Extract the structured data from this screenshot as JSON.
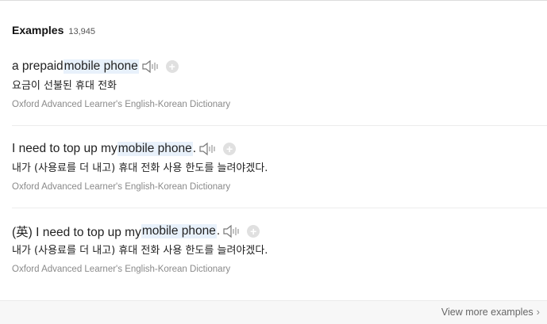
{
  "header": {
    "title": "Examples",
    "count": "13,945"
  },
  "examples": [
    {
      "pre": "a prepaid ",
      "highlight": "mobile phone",
      "post": "",
      "translation": "요금이 선불된 휴대 전화",
      "source": "Oxford Advanced Learner's English-Korean Dictionary"
    },
    {
      "pre": "I need to top up my ",
      "highlight": "mobile phone",
      "post": ".",
      "translation": "내가 (사용료를 더 내고) 휴대 전화 사용 한도를 늘려야겠다.",
      "source": "Oxford Advanced Learner's English-Korean Dictionary"
    },
    {
      "pre": "(英) I need to top up my ",
      "highlight": "mobile phone",
      "post": ".",
      "translation": "내가 (사용료를 더 내고) 휴대 전화 사용 한도를 늘려야겠다.",
      "source": "Oxford Advanced Learner's English-Korean Dictionary"
    }
  ],
  "plus_symbol": "+",
  "footer": {
    "more_label": "View more examples",
    "chevron": "›"
  },
  "icons": {
    "speaker": "speaker-icon",
    "add": "add-icon"
  }
}
